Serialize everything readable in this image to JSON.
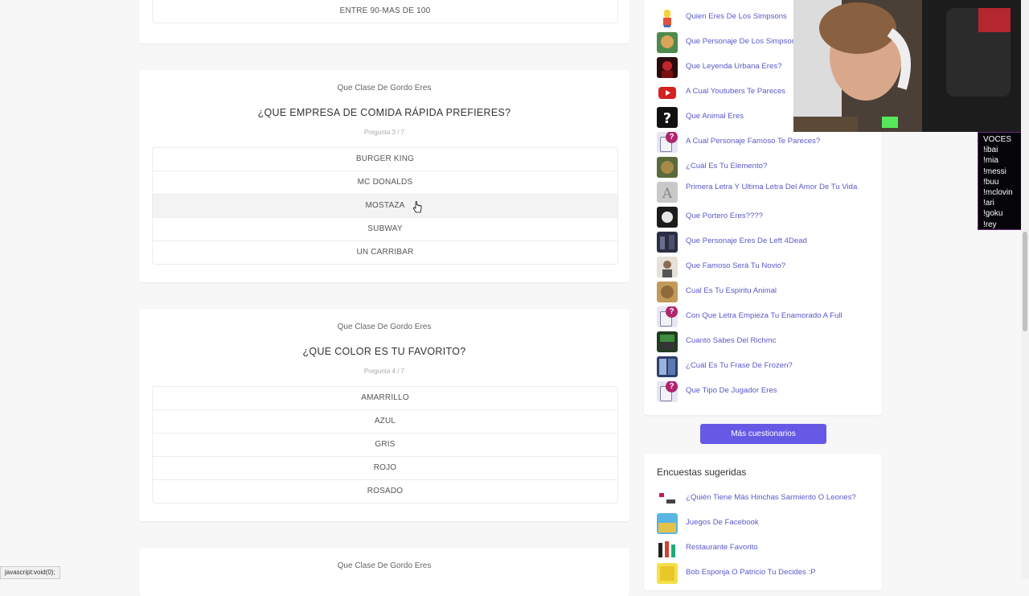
{
  "top_partial": {
    "option": "ENTRE 90-MAS DE 100"
  },
  "quiz_cards": [
    {
      "subtitle": "Que Clase De Gordo Eres",
      "question": "¿QUE EMPRESA DE COMIDA RÁPIDA PREFIERES?",
      "progress": "Pregunta 3 / 7",
      "options": [
        "BURGER KING",
        "MC DONALDS",
        "MOSTAZA",
        "SUBWAY",
        "UN CARRIBAR"
      ]
    },
    {
      "subtitle": "Que Clase De Gordo Eres",
      "question": "¿QUE COLOR ES TU FAVORITO?",
      "progress": "Pregunta 4 / 7",
      "options": [
        "AMARRILLO",
        "AZUL",
        "GRIS",
        "ROJO",
        "ROSADO"
      ]
    },
    {
      "subtitle": "Que Clase De Gordo Eres"
    }
  ],
  "sidebar_quizzes": [
    "Quien Eres De Los Simpsons",
    "Que Personaje De Los Simpsons",
    "Que Leyenda Urbana Eres?",
    "A Cual Youtubers Te Pareces",
    "Que Animal Eres",
    "A Cual Personaje Famoso Te Pareces?",
    "¿Cuál Es Tu Elemento?",
    "Primera Letra Y Ultima Letra Del Amor De Tu Vida",
    "Que Portero Eres????",
    "Que Personaje Eres De Left 4Dead",
    "Que Famoso Será Tu Novio?",
    "Cual Es Tu Espiritu Animal",
    "Con Que Letra Empieza Tu Enamorado A Full",
    "Cuanto Sabes Del Richmc",
    "¿Cuál Es Tu Frase De Frozen?",
    "Que Tipo De Jugador Eres"
  ],
  "more_button": "Más cuestionarios",
  "suggested_polls": {
    "title": "Encuestas sugeridas",
    "items": [
      "¿Quién Tiene Más Hinchas Sarmiento O Leones?",
      "Juegos De Facebook",
      "Restaurante Favorito",
      "Bob Esponja O Patricio Tu Decides :P"
    ]
  },
  "voces_overlay": [
    "VOCES",
    "!ibai",
    "!mia",
    "!messi",
    "!buu",
    "!mclovin",
    "!ari",
    "!goku",
    "!rey"
  ],
  "status_bar": "javascript:void(0);",
  "colors": {
    "accent": "#6659e6",
    "link": "#5b58c9",
    "question_badge": "#b0246e"
  }
}
